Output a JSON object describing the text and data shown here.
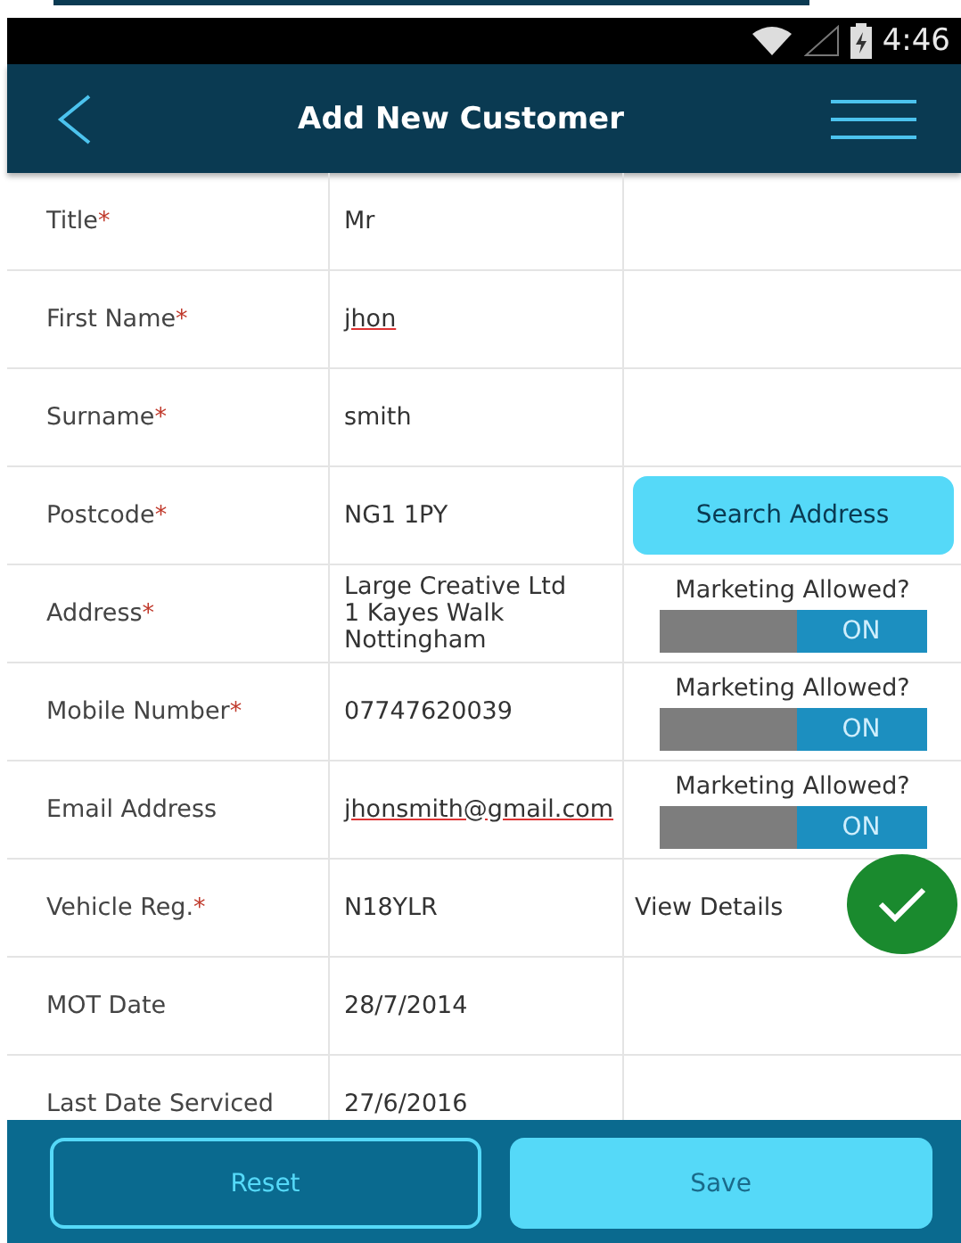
{
  "status_bar": {
    "time": "4:46"
  },
  "app_bar": {
    "title": "Add New Customer"
  },
  "rows": [
    {
      "label": "Title",
      "required_mark": "*",
      "value": "Mr",
      "misspelled": false
    },
    {
      "label": "First Name",
      "required_mark": "*",
      "value": "jhon",
      "misspelled": true
    },
    {
      "label": "Surname",
      "required_mark": "*",
      "value": "smith",
      "misspelled": false
    },
    {
      "label": "Postcode",
      "required_mark": "*",
      "value": "NG1 1PY",
      "misspelled": false,
      "extra": {
        "kind": "button",
        "label": "Search Address"
      }
    },
    {
      "label": "Address",
      "required_mark": "*",
      "value": "Large Creative Ltd\n1 Kayes Walk\nNottingham",
      "misspelled": false,
      "extra": {
        "kind": "toggle",
        "label": "Marketing Allowed?",
        "on": true,
        "state_text": "ON"
      }
    },
    {
      "label": "Mobile Number",
      "required_mark": "*",
      "value": "07747620039",
      "misspelled": false,
      "extra": {
        "kind": "toggle",
        "label": "Marketing Allowed?",
        "on": true,
        "state_text": "ON"
      }
    },
    {
      "label": "Email Address",
      "value": "jhonsmith@gmail.com",
      "misspelled": true,
      "extra": {
        "kind": "toggle",
        "label": "Marketing Allowed?",
        "on": true,
        "state_text": "ON"
      }
    },
    {
      "label": "Vehicle Reg.",
      "required_mark": "*",
      "value": "N18YLR",
      "misspelled": false,
      "extra": {
        "kind": "link",
        "label": "View Details"
      }
    },
    {
      "label": "MOT Date",
      "value": "28/7/2014",
      "misspelled": false
    },
    {
      "label": "Last Date Serviced",
      "value": "27/6/2016",
      "misspelled": false
    }
  ],
  "buttons": [
    {
      "label": "Reset",
      "kind": "outline"
    },
    {
      "label": "Save",
      "kind": "filled"
    }
  ]
}
